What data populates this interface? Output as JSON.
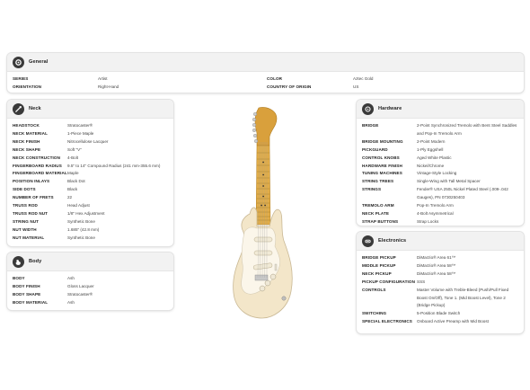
{
  "general": {
    "title": "General",
    "rows": [
      {
        "k1": "SERIES",
        "v1": "Artist",
        "k2": "COLOR",
        "v2": "Aztec Gold"
      },
      {
        "k1": "ORIENTATION",
        "v1": "Right-Hand",
        "k2": "COUNTRY OF ORIGIN",
        "v2": "US"
      }
    ]
  },
  "neck": {
    "title": "Neck",
    "rows": [
      {
        "k": "HEADSTOCK",
        "v": "Stratocaster®"
      },
      {
        "k": "NECK MATERIAL",
        "v": "1-Piece Maple"
      },
      {
        "k": "NECK FINISH",
        "v": "Nitrocellulose Lacquer"
      },
      {
        "k": "NECK SHAPE",
        "v": "Soft \"V\""
      },
      {
        "k": "NECK CONSTRUCTION",
        "v": "4-Bolt"
      },
      {
        "k": "FINGERBOARD RADIUS",
        "v": "9.5\" to 14\" Compound Radius (241 mm-355.6 mm)"
      },
      {
        "k": "FINGERBOARD MATERIAL",
        "v": "Maple"
      },
      {
        "k": "POSITION INLAYS",
        "v": "Black Dot"
      },
      {
        "k": "SIDE DOTS",
        "v": "Black"
      },
      {
        "k": "NUMBER OF FRETS",
        "v": "22"
      },
      {
        "k": "TRUSS ROD",
        "v": "Head Adjust"
      },
      {
        "k": "TRUSS ROD NUT",
        "v": "1/8\" Hex Adjustment"
      },
      {
        "k": "STRING NUT",
        "v": "Synthetic Bone"
      },
      {
        "k": "NUT WIDTH",
        "v": "1.685\" (42.8 mm)"
      },
      {
        "k": "NUT MATERIAL",
        "v": "Synthetic Bone"
      }
    ]
  },
  "body": {
    "title": "Body",
    "rows": [
      {
        "k": "BODY",
        "v": "Ash"
      },
      {
        "k": "BODY FINISH",
        "v": "Gloss Lacquer"
      },
      {
        "k": "BODY SHAPE",
        "v": "Stratocaster®"
      },
      {
        "k": "BODY MATERIAL",
        "v": "Ash"
      }
    ]
  },
  "hardware": {
    "title": "Hardware",
    "rows": [
      {
        "k": "BRIDGE",
        "v": "2-Point Synchronized Tremolo with Bent Steel Saddles and Pop-In Tremolo Arm"
      },
      {
        "k": "BRIDGE MOUNTING",
        "v": "2-Point Modern"
      },
      {
        "k": "PICKGUARD",
        "v": "1-Ply Eggshell"
      },
      {
        "k": "CONTROL KNOBS",
        "v": "Aged White Plastic"
      },
      {
        "k": "HARDWARE FINISH",
        "v": "Nickel/Chrome"
      },
      {
        "k": "TUNING MACHINES",
        "v": "Vintage-Style Locking"
      },
      {
        "k": "STRING TREES",
        "v": "Single-Wing with Tall Metal Spacer"
      },
      {
        "k": "STRINGS",
        "v": "Fender® USA 250L Nickel Plated Steel (.009-.042 Gauges), PN 0730250403"
      },
      {
        "k": "TREMOLO ARM",
        "v": "Pop-In Tremolo Arm"
      },
      {
        "k": "NECK PLATE",
        "v": "4-Bolt Asymmetrical"
      },
      {
        "k": "STRAP BUTTONS",
        "v": "Strap Locks"
      }
    ]
  },
  "electronics": {
    "title": "Electronics",
    "rows": [
      {
        "k": "BRIDGE PICKUP",
        "v": "DiMarzio® Area 61™"
      },
      {
        "k": "MIDDLE PICKUP",
        "v": "DiMarzio® Area 58™"
      },
      {
        "k": "NECK PICKUP",
        "v": "DiMarzio® Area 58™"
      },
      {
        "k": "PICKUP CONFIGURATION",
        "v": "SSS"
      },
      {
        "k": "CONTROLS",
        "v": "Master Volume with Treble-Bleed (Push/Pull Fixed Boost On/Off), Tone 1. (Mid Boost Level), Tone 2 (Bridge Pickup)"
      },
      {
        "k": "SWITCHING",
        "v": "5-Position Blade Switch"
      },
      {
        "k": "SPECIAL ELECTRONICS",
        "v": "Onboard Active Preamp with Mid Boost"
      }
    ]
  },
  "product_image": {
    "alt_icon": "guitar-image"
  }
}
